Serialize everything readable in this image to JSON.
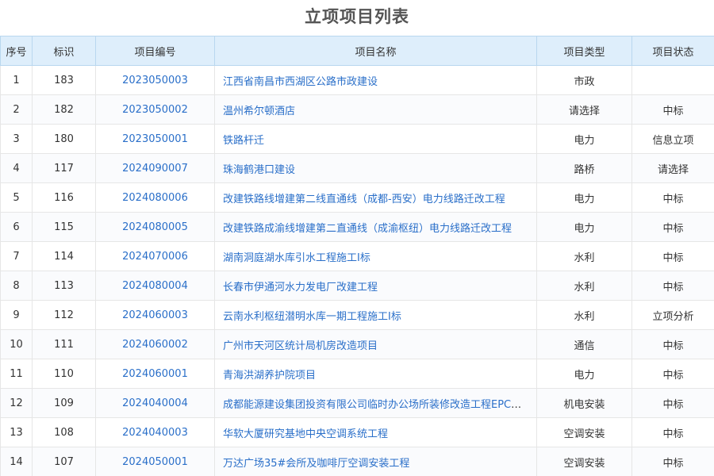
{
  "page": {
    "title": "立项项目列表"
  },
  "table": {
    "headers": {
      "seq": "序号",
      "id": "标识",
      "code": "项目编号",
      "name": "项目名称",
      "type": "项目类型",
      "status": "项目状态"
    },
    "rows": [
      {
        "seq": "1",
        "id": "183",
        "code": "2023050003",
        "name": "江西省南昌市西湖区公路市政建设",
        "type": "市政",
        "status": ""
      },
      {
        "seq": "2",
        "id": "182",
        "code": "2023050002",
        "name": "温州希尔顿酒店",
        "type": "请选择",
        "status": "中标"
      },
      {
        "seq": "3",
        "id": "180",
        "code": "2023050001",
        "name": "铁路杆迁",
        "type": "电力",
        "status": "信息立项"
      },
      {
        "seq": "4",
        "id": "117",
        "code": "2024090007",
        "name": "珠海鹤港口建设",
        "type": "路桥",
        "status": "请选择"
      },
      {
        "seq": "5",
        "id": "116",
        "code": "2024080006",
        "name": "改建铁路线增建第二线直通线（成都-西安）电力线路迁改工程",
        "type": "电力",
        "status": "中标"
      },
      {
        "seq": "6",
        "id": "115",
        "code": "2024080005",
        "name": "改建铁路成渝线增建第二直通线（成渝枢纽）电力线路迁改工程",
        "type": "电力",
        "status": "中标"
      },
      {
        "seq": "7",
        "id": "114",
        "code": "2024070006",
        "name": "湖南洞庭湖水库引水工程施工I标",
        "type": "水利",
        "status": "中标"
      },
      {
        "seq": "8",
        "id": "113",
        "code": "2024080004",
        "name": "长春市伊通河水力发电厂改建工程",
        "type": "水利",
        "status": "中标"
      },
      {
        "seq": "9",
        "id": "112",
        "code": "2024060003",
        "name": "云南水利枢纽潜明水库一期工程施工I标",
        "type": "水利",
        "status": "立项分析"
      },
      {
        "seq": "10",
        "id": "111",
        "code": "2024060002",
        "name": "广州市天河区统计局机房改造项目",
        "type": "通信",
        "status": "中标"
      },
      {
        "seq": "11",
        "id": "110",
        "code": "2024060001",
        "name": "青海洪湖养护院项目",
        "type": "电力",
        "status": "中标"
      },
      {
        "seq": "12",
        "id": "109",
        "code": "2024040004",
        "name": "成都能源建设集团投资有限公司临时办公场所装修改造工程EPC总承包",
        "type": "机电安装",
        "status": "中标"
      },
      {
        "seq": "13",
        "id": "108",
        "code": "2024040003",
        "name": "华软大厦研究基地中央空调系统工程",
        "type": "空调安装",
        "status": "中标"
      },
      {
        "seq": "14",
        "id": "107",
        "code": "2024050001",
        "name": "万达广场35#会所及咖啡厅空调安装工程",
        "type": "空调安装",
        "status": "中标"
      }
    ]
  }
}
